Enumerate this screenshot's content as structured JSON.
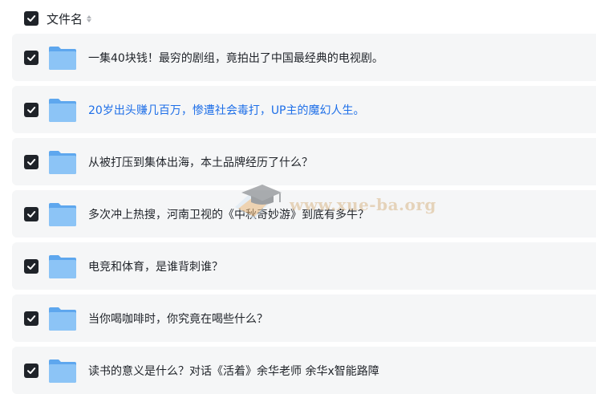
{
  "header": {
    "title": "文件名"
  },
  "rows": [
    {
      "label": "一集40块钱！最穷的剧组，竟拍出了中国最经典的电视剧。",
      "link": false
    },
    {
      "label": "20岁出头赚几百万，惨遭社会毒打，UP主的魔幻人生。",
      "link": true
    },
    {
      "label": "从被打压到集体出海，本土品牌经历了什么？",
      "link": false
    },
    {
      "label": "多次冲上热搜，河南卫视的《中秋奇妙游》到底有多牛？",
      "link": false
    },
    {
      "label": "电竞和体育，是谁背刺谁？",
      "link": false
    },
    {
      "label": "当你喝咖啡时，你究竟在喝些什么？",
      "link": false
    },
    {
      "label": "读书的意义是什么？对话《活着》余华老师 余华x智能路障",
      "link": false
    }
  ],
  "watermark": {
    "text": "www.xue-ba.org"
  },
  "colors": {
    "link": "#1e6fe8",
    "row_bg": "#f5f6f7",
    "checkbox": "#1f2329",
    "folder": "#6aaef0"
  }
}
